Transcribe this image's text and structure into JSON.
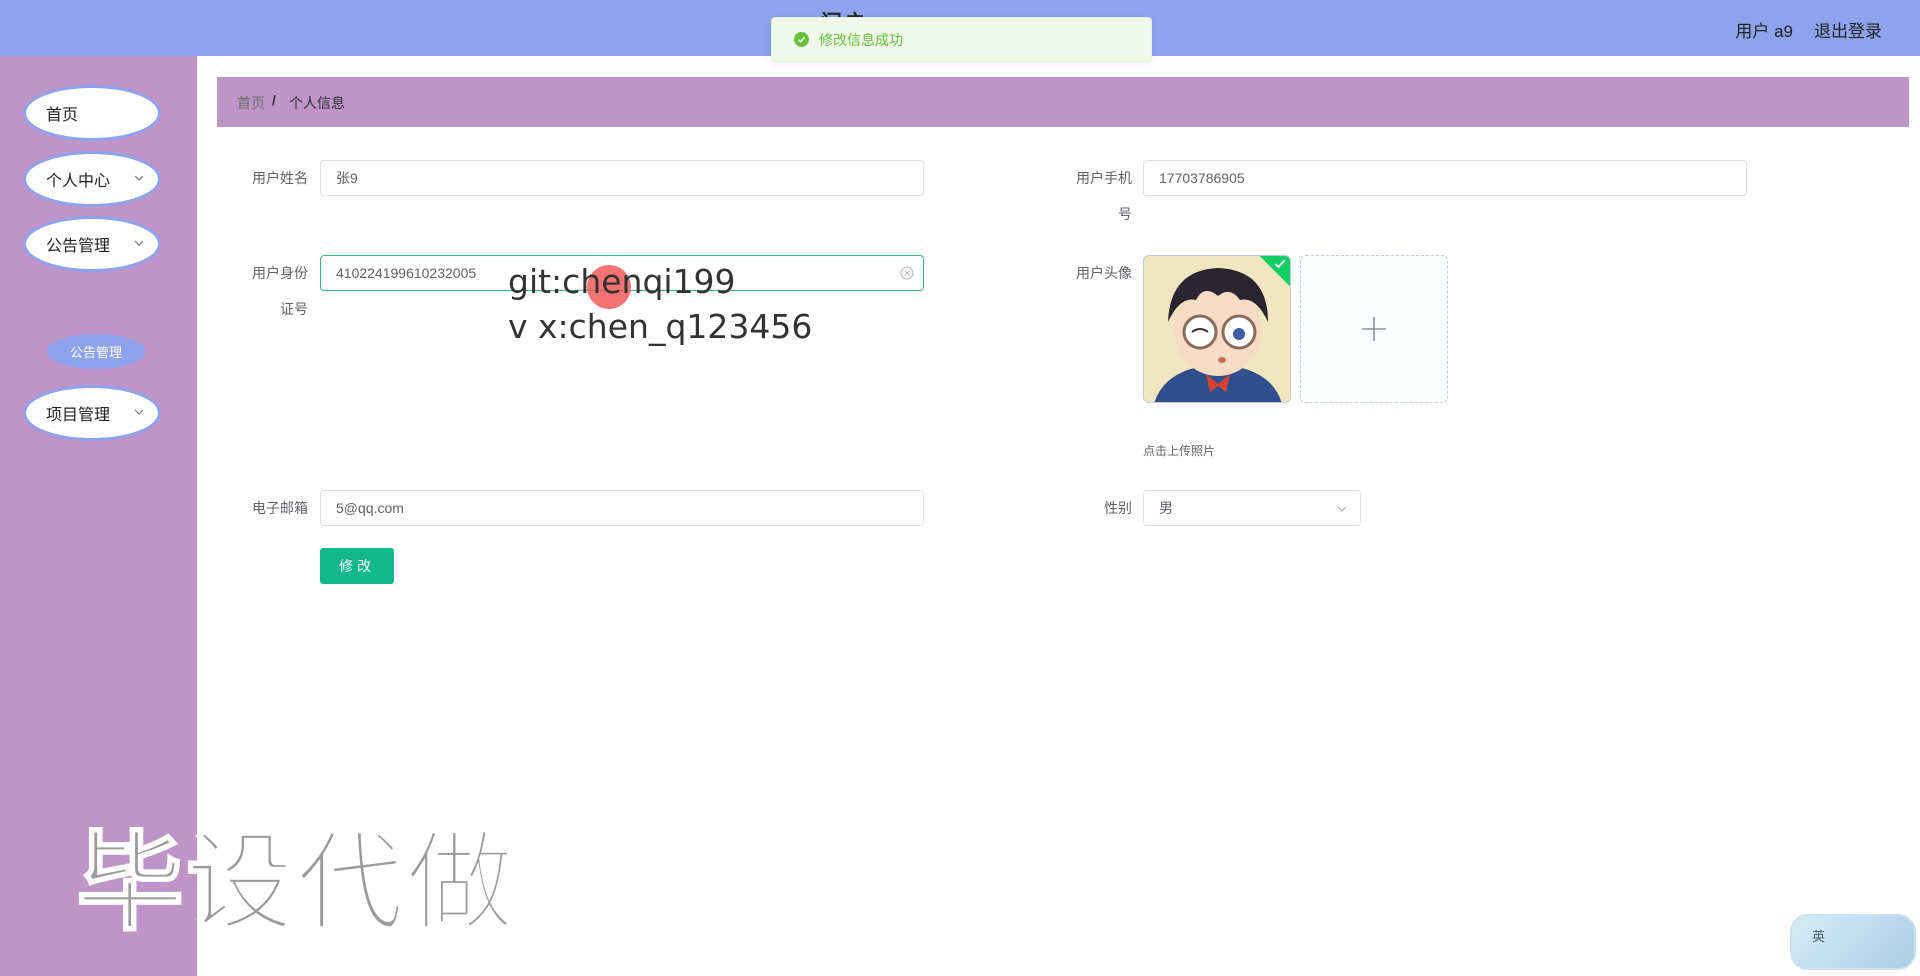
{
  "header": {
    "site_title": "门户",
    "user_label": "用户 a9",
    "logout_label": "退出登录"
  },
  "toast": {
    "message": "修改信息成功"
  },
  "sidebar": {
    "items": [
      {
        "label": "首页"
      },
      {
        "label": "个人中心"
      },
      {
        "label": "公告管理"
      },
      {
        "label": "项目管理"
      }
    ],
    "sub_item": {
      "label": "公告管理"
    }
  },
  "breadcrumb": {
    "home": "首页",
    "separator": "/",
    "current": "个人信息"
  },
  "form": {
    "name_label": "用户姓名",
    "name_value": "张9",
    "phone_label_1": "用户手机",
    "phone_label_2": "号",
    "phone_value": "17703786905",
    "idcard_label_1": "用户身份",
    "idcard_label_2": "证号",
    "idcard_value": "410224199610232005",
    "avatar_label": "用户头像",
    "upload_tip": "点击上传照片",
    "email_label": "电子邮箱",
    "email_value": "5@qq.com",
    "gender_label": "性别",
    "gender_value": "男",
    "submit_label": "修改"
  },
  "overlay": {
    "line1": "git:chenqi199",
    "line2": "v x:chen_q123456",
    "watermark": "毕设代做",
    "ime": "英"
  }
}
